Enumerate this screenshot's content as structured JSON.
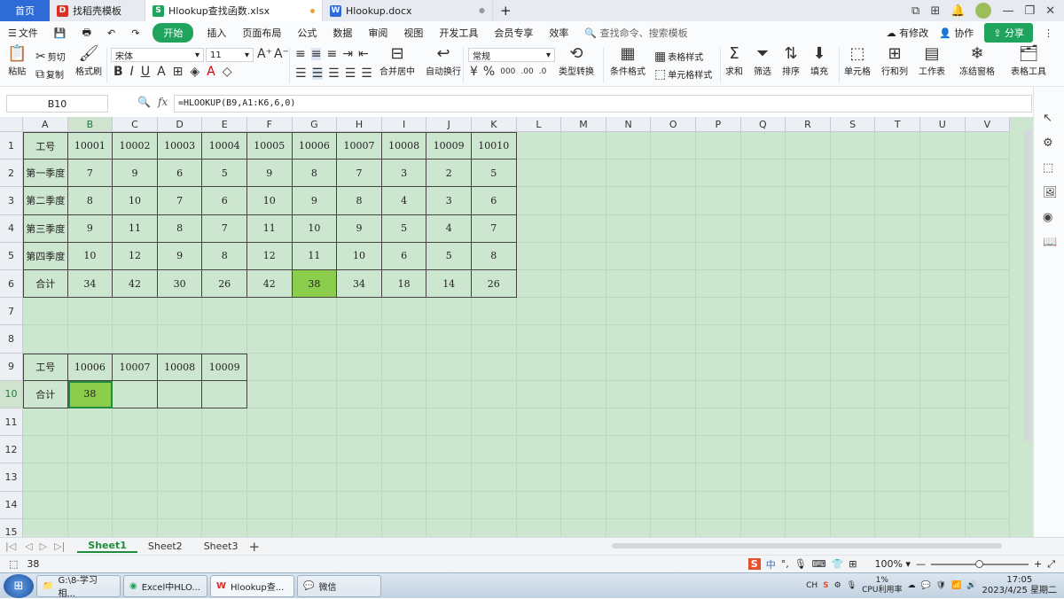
{
  "tabs": {
    "home": "首页",
    "items": [
      {
        "label": "找稻壳模板",
        "icon": "D",
        "color": "#d93025"
      },
      {
        "label": "Hlookup查找函数.xlsx",
        "icon": "S",
        "color": "#20a35c"
      },
      {
        "label": "Hlookup.docx",
        "icon": "W",
        "color": "#2f6bd6"
      }
    ],
    "new_tab": "+"
  },
  "menu": {
    "file": "文件",
    "items": [
      "开始",
      "插入",
      "页面布局",
      "公式",
      "数据",
      "审阅",
      "视图",
      "开发工具",
      "会员专享",
      "效率"
    ],
    "search": "查找命令、搜索模板",
    "modified": "有修改",
    "collab": "协作",
    "share": "分享"
  },
  "toolbar": {
    "cut": "剪切",
    "paste": "粘贴",
    "copy": "复制",
    "format_painter": "格式刷",
    "font": "宋体",
    "size": "11",
    "merge": "合并居中",
    "wrap": "自动换行",
    "number_format": "常规",
    "type_convert": "类型转换",
    "cond_format": "条件格式",
    "table_style": "表格样式",
    "cell_style": "单元格样式",
    "sum": "求和",
    "filter": "筛选",
    "sort": "排序",
    "fill": "填充",
    "cell": "单元格",
    "rowcol": "行和列",
    "worksheet": "工作表",
    "freeze": "冻结窗格",
    "tools": "表格工具"
  },
  "formula_bar": {
    "name_box": "B10",
    "formula": "=HLOOKUP(B9,A1:K6,6,0)"
  },
  "grid": {
    "columns": [
      "A",
      "B",
      "C",
      "D",
      "E",
      "F",
      "G",
      "H",
      "I",
      "J",
      "K",
      "L",
      "M",
      "N",
      "O",
      "P",
      "Q",
      "R",
      "S",
      "T",
      "U",
      "V"
    ],
    "rows": [
      "1",
      "2",
      "3",
      "4",
      "5",
      "6",
      "7",
      "8",
      "9",
      "10",
      "11",
      "12",
      "13",
      "14",
      "15"
    ],
    "table1": [
      [
        "工号",
        "10001",
        "10002",
        "10003",
        "10004",
        "10005",
        "10006",
        "10007",
        "10008",
        "10009",
        "10010"
      ],
      [
        "第一季度",
        "7",
        "9",
        "6",
        "5",
        "9",
        "8",
        "7",
        "3",
        "2",
        "5"
      ],
      [
        "第二季度",
        "8",
        "10",
        "7",
        "6",
        "10",
        "9",
        "8",
        "4",
        "3",
        "6"
      ],
      [
        "第三季度",
        "9",
        "11",
        "8",
        "7",
        "11",
        "10",
        "9",
        "5",
        "4",
        "7"
      ],
      [
        "第四季度",
        "10",
        "12",
        "9",
        "8",
        "12",
        "11",
        "10",
        "6",
        "5",
        "8"
      ],
      [
        "合计",
        "34",
        "42",
        "30",
        "26",
        "42",
        "38",
        "34",
        "18",
        "14",
        "26"
      ]
    ],
    "table2": [
      [
        "工号",
        "10006",
        "10007",
        "10008",
        "10009"
      ],
      [
        "合计",
        "38",
        "",
        "",
        ""
      ]
    ],
    "highlight_color": "#8cce4c"
  },
  "sheets": {
    "tabs": [
      "Sheet1",
      "Sheet2",
      "Sheet3"
    ],
    "add": "+"
  },
  "status": {
    "value": "38",
    "zoom": "100%",
    "ime": "中"
  },
  "taskbar": {
    "tasks": [
      "G:\\8-学习相...",
      "Excel中HLO...",
      "Hlookup查...",
      "微信"
    ],
    "lang": "CH",
    "cpu_percent": "1%",
    "cpu_label": "CPU利用率",
    "time": "17:05",
    "date": "2023/4/25 星期二"
  }
}
